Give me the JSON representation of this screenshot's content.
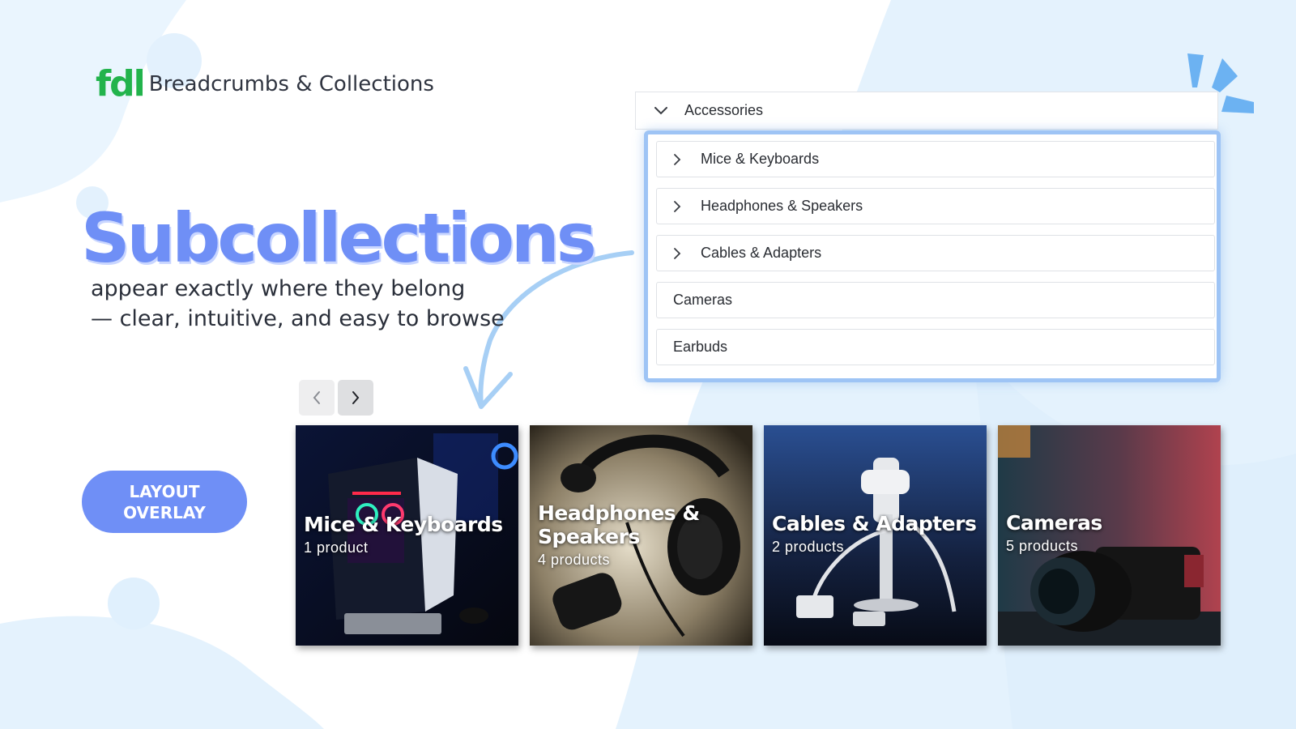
{
  "brand": {
    "logo": "fdl",
    "title": "Breadcrumbs & Collections"
  },
  "hero": {
    "headline": "Subcollections",
    "subline_1": "appear exactly where they belong",
    "subline_2": "— clear, intuitive, and easy to browse"
  },
  "layout_badge": {
    "line_1": "LAYOUT",
    "line_2": "OVERLAY"
  },
  "tree": {
    "parent": {
      "label": "Accessories",
      "icon": "chevron-down-icon"
    },
    "children": [
      {
        "label": "Mice & Keyboards",
        "icon": "chevron-right-icon"
      },
      {
        "label": "Headphones & Speakers",
        "icon": "chevron-right-icon"
      },
      {
        "label": "Cables & Adapters",
        "icon": "chevron-right-icon"
      },
      {
        "label": "Cameras"
      },
      {
        "label": "Earbuds"
      }
    ]
  },
  "carousel": {
    "prev_icon": "chevron-left-icon",
    "next_icon": "chevron-right-icon",
    "cards": [
      {
        "title": "Mice & Keyboards",
        "count": "1 product"
      },
      {
        "title": "Headphones & Speakers",
        "count": "4 products"
      },
      {
        "title": "Cables & Adapters",
        "count": "2 products"
      },
      {
        "title": "Cameras",
        "count": "5 products"
      }
    ]
  },
  "colors": {
    "accent": "#6f8ff6",
    "logo_green": "#22b34c",
    "highlight_border": "#9ec4f5",
    "background_blob": "#e4f2fd"
  }
}
